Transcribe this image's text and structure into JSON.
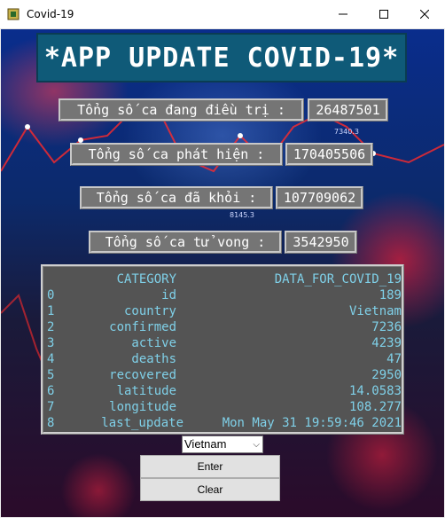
{
  "window": {
    "title": "Covid-19"
  },
  "banner": {
    "text": "*APP UPDATE COVID-19*"
  },
  "stats": [
    {
      "label": "Tổng số ca đang điều trị :",
      "value": "26487501"
    },
    {
      "label": "Tổng số ca phát hiện :",
      "value": "170405506"
    },
    {
      "label": "Tổng số ca đã khỏi :",
      "value": "107709062"
    },
    {
      "label": "Tổng số ca tử vong :",
      "value": "3542950"
    }
  ],
  "table": {
    "header": {
      "category": "CATEGORY",
      "data": "DATA_FOR_COVID_19"
    },
    "rows": [
      {
        "index": "0",
        "category": "id",
        "value": "189"
      },
      {
        "index": "1",
        "category": "country",
        "value": "Vietnam"
      },
      {
        "index": "2",
        "category": "confirmed",
        "value": "7236"
      },
      {
        "index": "3",
        "category": "active",
        "value": "4239"
      },
      {
        "index": "4",
        "category": "deaths",
        "value": "47"
      },
      {
        "index": "5",
        "category": "recovered",
        "value": "2950"
      },
      {
        "index": "6",
        "category": "latitude",
        "value": "14.0583"
      },
      {
        "index": "7",
        "category": "longitude",
        "value": "108.277"
      },
      {
        "index": "8",
        "category": "last_update",
        "value": "Mon May 31 19:59:46 2021"
      }
    ]
  },
  "controls": {
    "country_select": "Vietnam",
    "enter_label": "Enter",
    "clear_label": "Clear"
  },
  "background_text": {
    "a": "7340.3",
    "b": "8145.3"
  },
  "colors": {
    "banner": "#0f5a78",
    "label_bg": "#757575",
    "table_text": "#7fd0e8"
  }
}
